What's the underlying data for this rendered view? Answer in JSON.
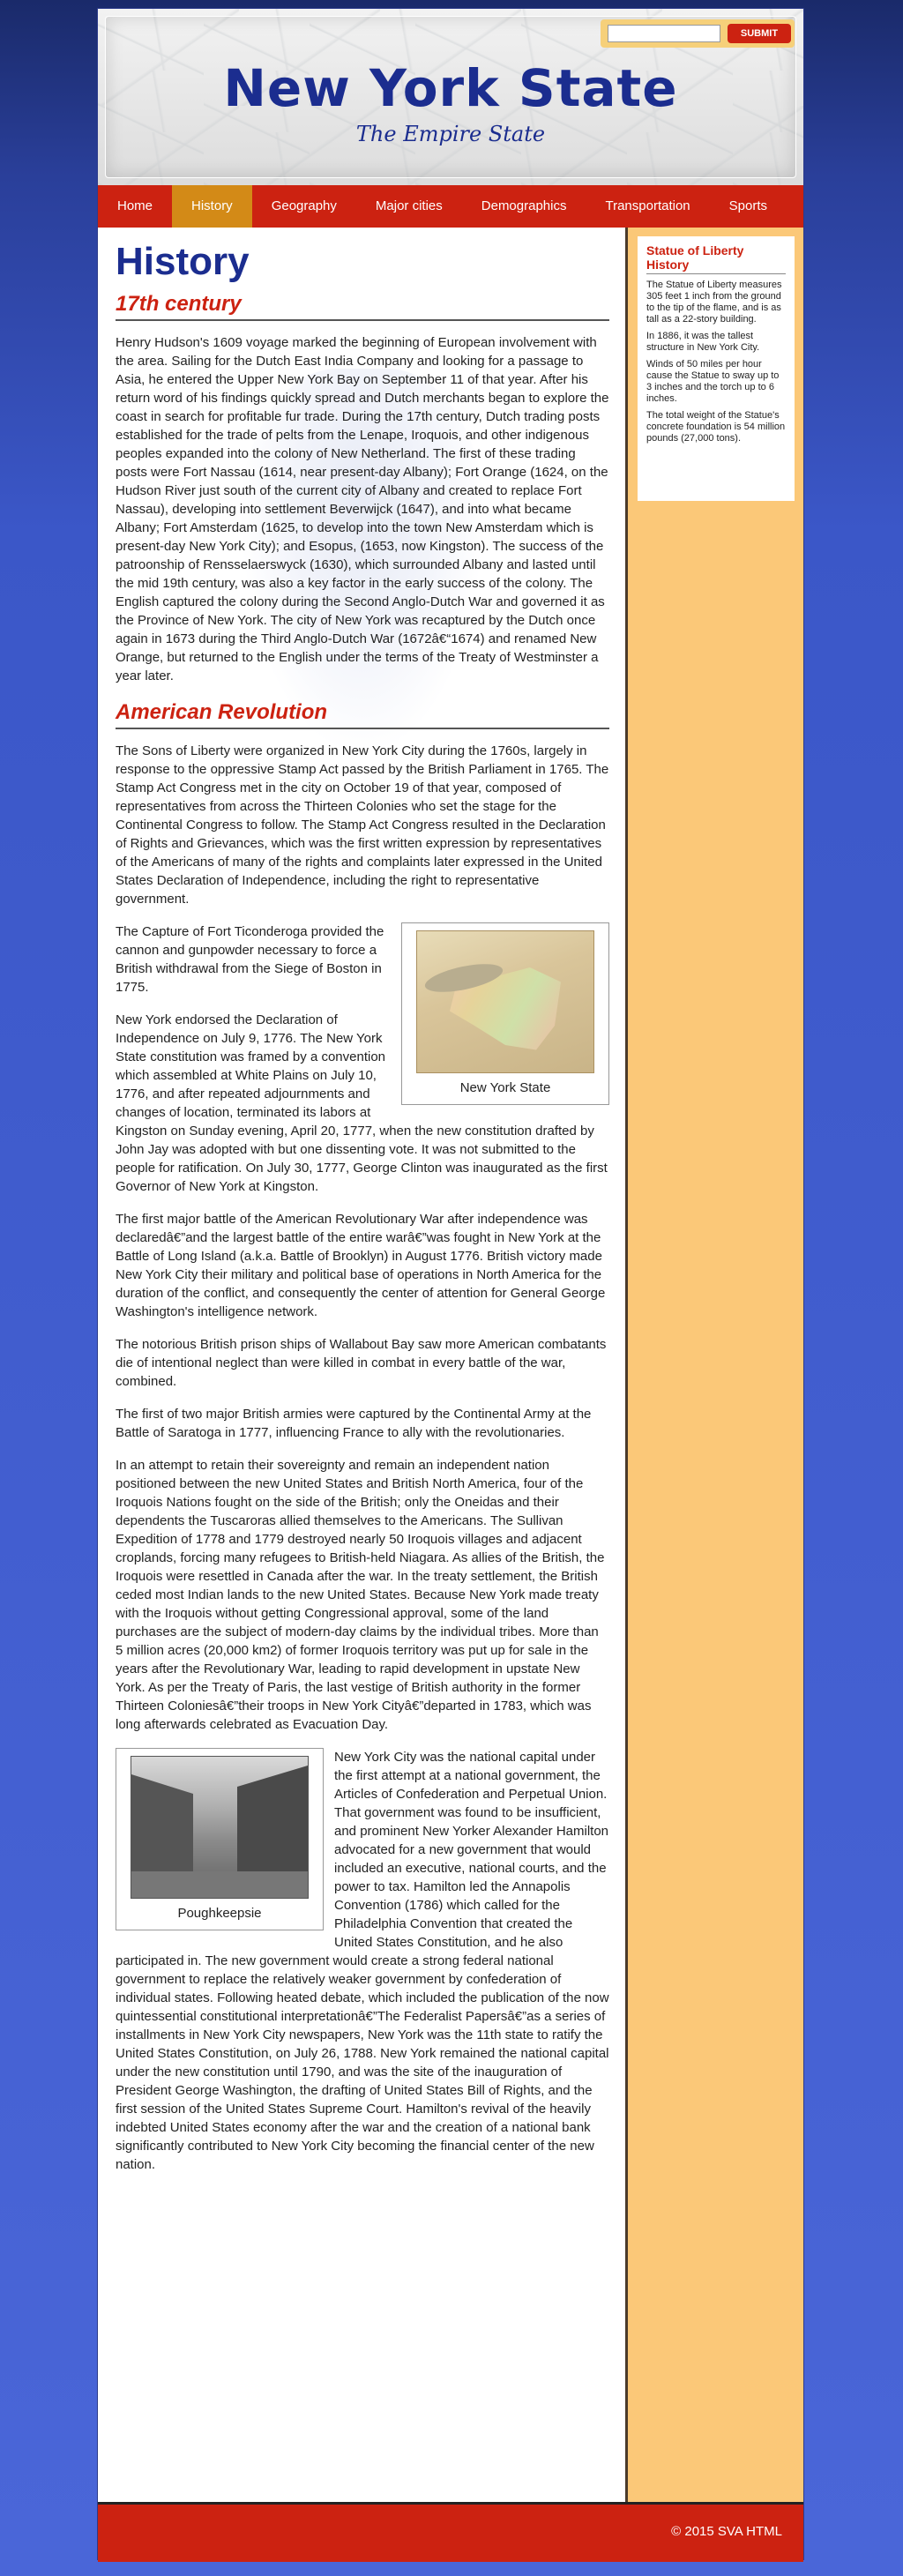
{
  "site": {
    "title": "New York State",
    "tagline": "The Empire State"
  },
  "search": {
    "placeholder": "",
    "submit_label": "SUBMIT"
  },
  "nav": {
    "items": [
      {
        "label": "Home"
      },
      {
        "label": "History"
      },
      {
        "label": "Geography"
      },
      {
        "label": "Major cities"
      },
      {
        "label": "Demographics"
      },
      {
        "label": "Transportation"
      },
      {
        "label": "Sports"
      }
    ],
    "active": "History"
  },
  "main": {
    "heading": "History",
    "sections": [
      {
        "heading": "17th century",
        "paragraphs": [
          "Henry Hudson's 1609 voyage marked the beginning of European involvement with the area. Sailing for the Dutch East India Company and looking for a passage to Asia, he entered the Upper New York Bay on September 11 of that year. After his return word of his findings quickly spread and Dutch merchants began to explore the coast in search for profitable fur trade. During the 17th century, Dutch trading posts established for the trade of pelts from the Lenape, Iroquois, and other indigenous peoples expanded into the colony of New Netherland. The first of these trading posts were Fort Nassau (1614, near present-day Albany); Fort Orange (1624, on the Hudson River just south of the current city of Albany and created to replace Fort Nassau), developing into settlement Beverwijck (1647), and into what became Albany; Fort Amsterdam (1625, to develop into the town New Amsterdam which is present-day New York City); and Esopus, (1653, now Kingston). The success of the patroonship of Rensselaerswyck (1630), which surrounded Albany and lasted until the mid 19th century, was also a key factor in the early success of the colony. The English captured the colony during the Second Anglo-Dutch War and governed it as the Province of New York. The city of New York was recaptured by the Dutch once again in 1673 during the Third Anglo-Dutch War (1672â€“1674) and renamed New Orange, but returned to the English under the terms of the Treaty of Westminster a year later."
        ]
      },
      {
        "heading": "American Revolution",
        "paragraphs": [
          "The Sons of Liberty were organized in New York City during the 1760s, largely in response to the oppressive Stamp Act passed by the British Parliament in 1765. The Stamp Act Congress met in the city on October 19 of that year, composed of representatives from across the Thirteen Colonies who set the stage for the Continental Congress to follow. The Stamp Act Congress resulted in the Declaration of Rights and Grievances, which was the first written expression by representatives of the Americans of many of the rights and complaints later expressed in the United States Declaration of Independence, including the right to representative government.",
          "The Capture of Fort Ticonderoga provided the cannon and gunpowder necessary to force a British withdrawal from the Siege of Boston in 1775.",
          "New York endorsed the Declaration of Independence on July 9, 1776. The New York State constitution was framed by a convention which assembled at White Plains on July 10, 1776, and after repeated adjournments and changes of location, terminated its labors at Kingston on Sunday evening, April 20, 1777, when the new constitution drafted by John Jay was adopted with but one dissenting vote. It was not submitted to the people for ratification. On July 30, 1777, George Clinton was inaugurated as the first Governor of New York at Kingston.",
          "The first major battle of the American Revolutionary War after independence was declaredâ€”and the largest battle of the entire warâ€”was fought in New York at the Battle of Long Island (a.k.a. Battle of Brooklyn) in August 1776. British victory made New York City their military and political base of operations in North America for the duration of the conflict, and consequently the center of attention for General George Washington's intelligence network.",
          "The notorious British prison ships of Wallabout Bay saw more American combatants die of intentional neglect than were killed in combat in every battle of the war, combined.",
          "The first of two major British armies were captured by the Continental Army at the Battle of Saratoga in 1777, influencing France to ally with the revolutionaries.",
          "In an attempt to retain their sovereignty and remain an independent nation positioned between the new United States and British North America, four of the Iroquois Nations fought on the side of the British; only the Oneidas and their dependents the Tuscaroras allied themselves to the Americans. The Sullivan Expedition of 1778 and 1779 destroyed nearly 50 Iroquois villages and adjacent croplands, forcing many refugees to British-held Niagara. As allies of the British, the Iroquois were resettled in Canada after the war. In the treaty settlement, the British ceded most Indian lands to the new United States. Because New York made treaty with the Iroquois without getting Congressional approval, some of the land purchases are the subject of modern-day claims by the individual tribes. More than 5 million acres (20,000 km2) of former Iroquois territory was put up for sale in the years after the Revolutionary War, leading to rapid development in upstate New York. As per the Treaty of Paris, the last vestige of British authority in the former Thirteen Coloniesâ€”their troops in New York Cityâ€”departed in 1783, which was long afterwards celebrated as Evacuation Day.",
          "New York City was the national capital under the first attempt at a national government, the Articles of Confederation and Perpetual Union. That government was found to be insufficient, and prominent New Yorker Alexander Hamilton advocated for a new government that would included an executive, national courts, and the power to tax. Hamilton led the Annapolis Convention (1786) which called for the Philadelphia Convention that created the United States Constitution, and he also participated in. The new government would create a strong federal national government to replace the relatively weaker government by confederation of individual states. Following heated debate, which included the publication of the now quintessential constitutional interpretationâ€”The Federalist Papersâ€”as a series of installments in New York City newspapers, New York was the 11th state to ratify the United States Constitution, on July 26, 1788. New York remained the national capital under the new constitution until 1790, and was the site of the inauguration of President George Washington, the drafting of United States Bill of Rights, and the first session of the United States Supreme Court. Hamilton's revival of the heavily indebted United States economy after the war and the creation of a national bank significantly contributed to New York City becoming the financial center of the new nation."
        ],
        "figures": [
          {
            "caption": "New York State"
          },
          {
            "caption": "Poughkeepsie"
          }
        ]
      }
    ]
  },
  "sidebar": {
    "title": "Statue of Liberty History",
    "facts": [
      "The Statue of Liberty measures 305 feet 1 inch from the ground to the tip of the flame, and is as tall as a 22-story building.",
      "In 1886, it was the tallest structure in New York City.",
      "Winds of 50 miles per hour cause the Statue to sway up to 3 inches and the torch up to 6 inches.",
      "The total weight of the Statue's concrete foundation is 54 million pounds (27,000 tons)."
    ]
  },
  "footer": {
    "text": "© 2015 SVA HTML"
  },
  "colors": {
    "brand_blue": "#1b2d8f",
    "nav_red": "#cc2211",
    "nav_active": "#d38a17",
    "sidebar_bg": "#fbc878"
  }
}
